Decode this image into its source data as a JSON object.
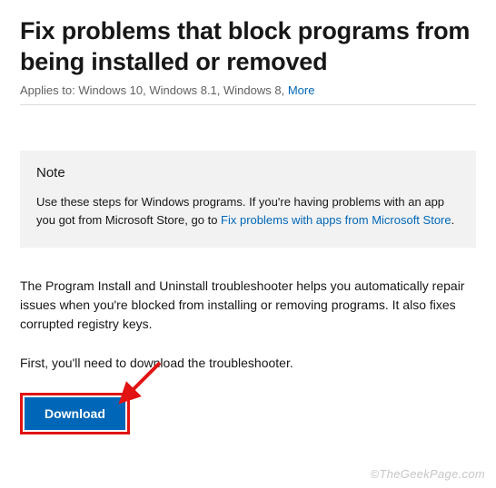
{
  "title": "Fix problems that block programs from being installed or removed",
  "applies": {
    "prefix": "Applies to: ",
    "list": "Windows 10, Windows 8.1, Windows 8, ",
    "more": "More"
  },
  "note": {
    "heading": "Note",
    "body_before": "Use these steps for Windows programs. If you're having problems with an app you got from Microsoft Store, go to ",
    "link_text": "Fix problems with apps from Microsoft Store",
    "body_after": "."
  },
  "paragraphs": {
    "p1": "The Program Install and Uninstall troubleshooter helps you automatically repair issues when you're blocked from installing or removing programs. It also fixes corrupted registry keys.",
    "p2": "First, you'll need to download the troubleshooter."
  },
  "download_label": "Download",
  "watermark": "©TheGeekPage.com"
}
